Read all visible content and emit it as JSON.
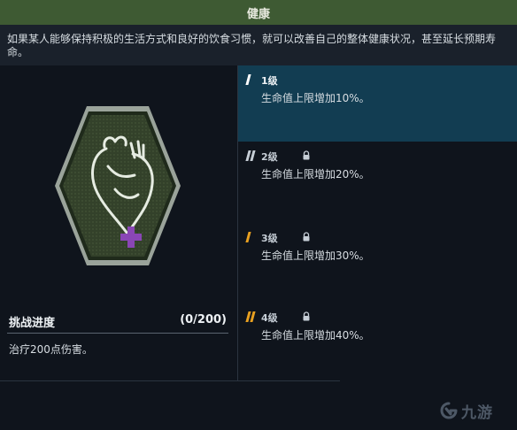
{
  "header": {
    "title": "健康"
  },
  "description": "如果某人能够保持积极的生活方式和良好的饮食习惯，就可以改善自己的整体健康状况，甚至延长预期寿命。",
  "badge": {
    "icon": "heart-plus-icon",
    "bg_color": "#3a4a2e",
    "accent_color": "#7a3fa3"
  },
  "challenge": {
    "title": "挑战进度",
    "progress": "(0/200)",
    "description": "治疗200点伤害。"
  },
  "levels": [
    {
      "name": "1级",
      "description": "生命值上限增加10%。",
      "locked": false,
      "active": true,
      "tick_color": "#ffffff"
    },
    {
      "name": "2级",
      "description": "生命值上限增加20%。",
      "locked": true,
      "active": false,
      "tick_color": "#e8a020"
    },
    {
      "name": "3级",
      "description": "生命值上限增加30%。",
      "locked": true,
      "active": false,
      "tick_color": "#e8a020"
    },
    {
      "name": "4级",
      "description": "生命值上限增加40%。",
      "locked": true,
      "active": false,
      "tick_color": "#e8a020"
    }
  ],
  "watermark": {
    "text": "九游"
  },
  "colors": {
    "header_bg": "#3e5a33",
    "active_level_bg": "#123d52",
    "tick_active": "#ffffff",
    "tick_locked": "#e8a020"
  }
}
